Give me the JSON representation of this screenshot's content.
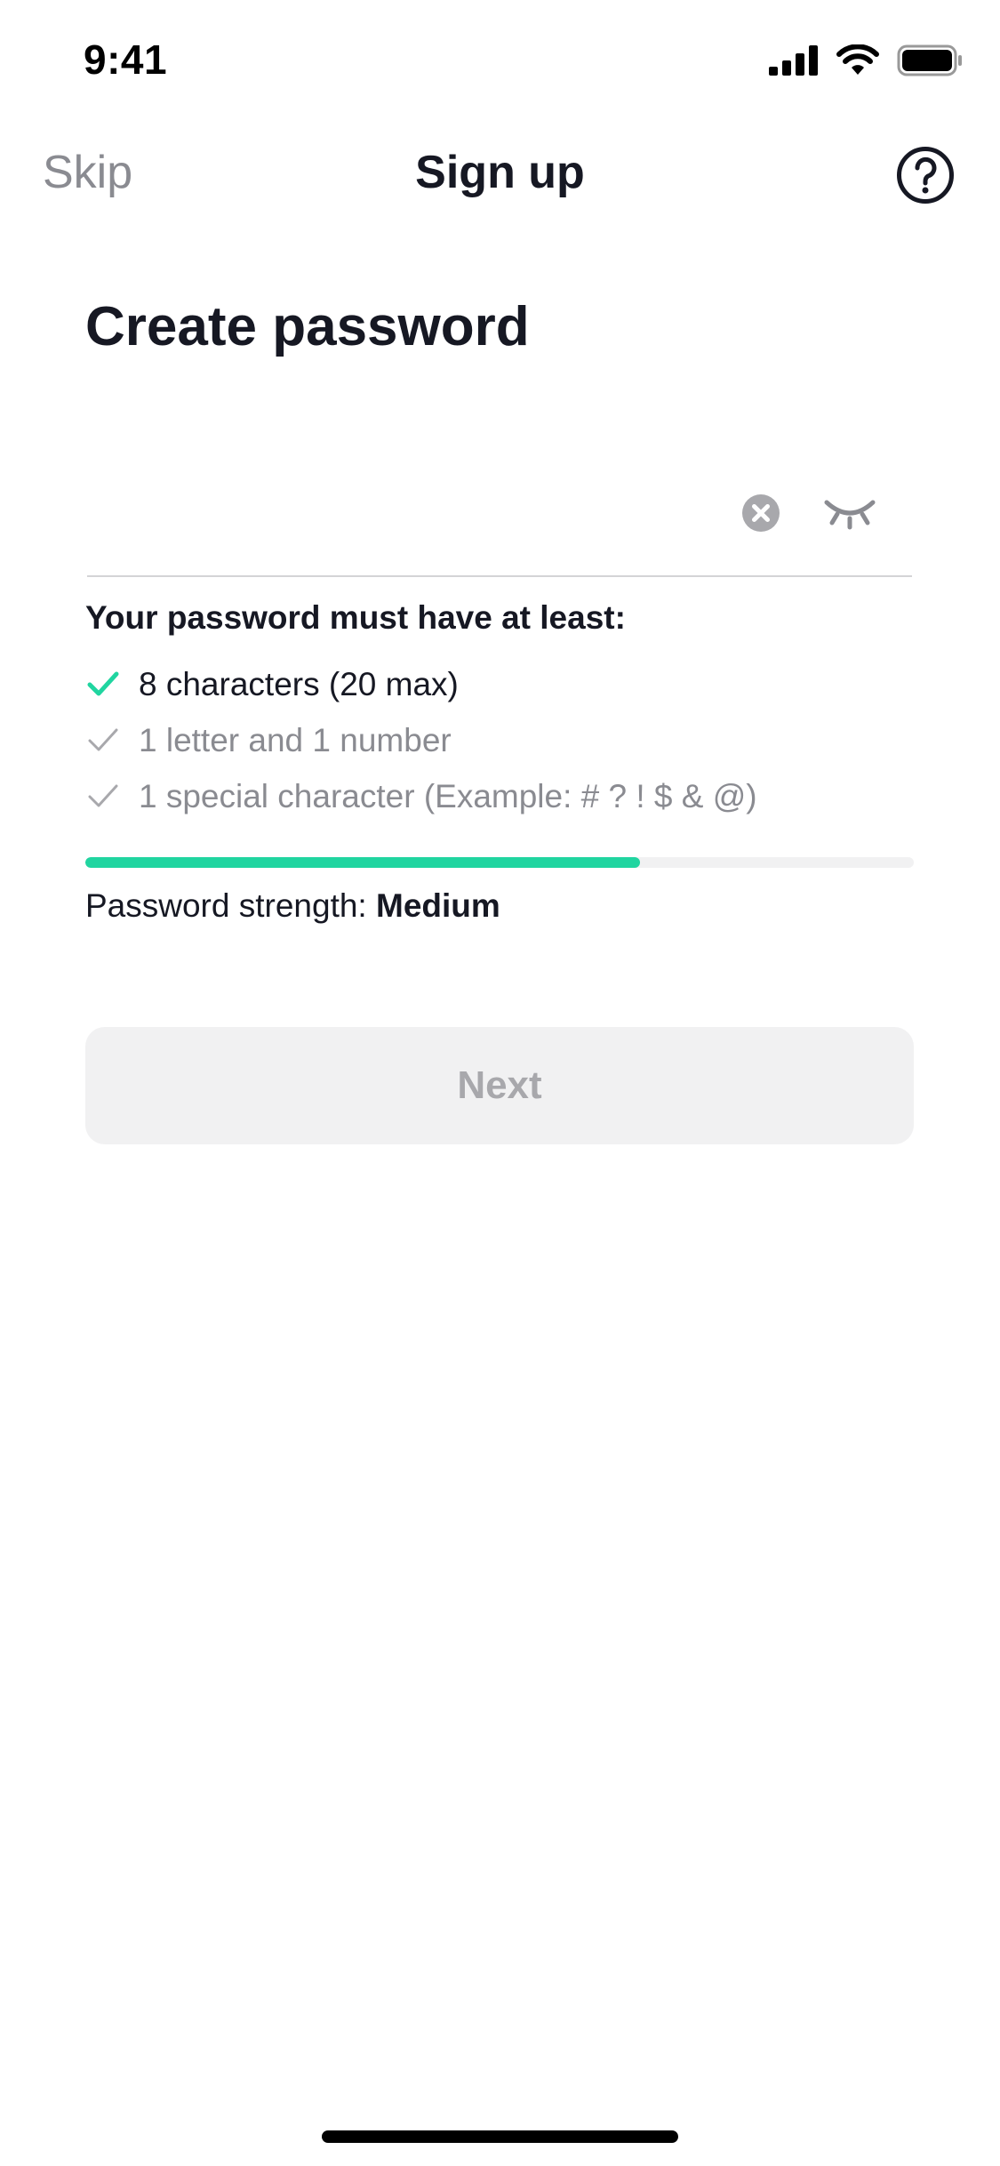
{
  "status_bar": {
    "time": "9:41"
  },
  "nav": {
    "skip_label": "Skip",
    "title": "Sign up",
    "help_icon": "question-circle-icon"
  },
  "page": {
    "title": "Create password"
  },
  "password_field": {
    "value": "",
    "placeholder": ""
  },
  "requirements": {
    "title": "Your password must have at least:",
    "items": [
      {
        "label": "8 characters (20 max)",
        "met": true
      },
      {
        "label": "1 letter and 1 number",
        "met": false
      },
      {
        "label": "1 special character (Example: # ? ! $ & @)",
        "met": false
      }
    ]
  },
  "strength": {
    "label": "Password strength:",
    "value": "Medium",
    "fill_fraction": 0.67
  },
  "next_button": {
    "label": "Next",
    "enabled": false
  },
  "colors": {
    "accent": "#20D5A0",
    "text": "#161823",
    "muted": "#8A8B91",
    "button_bg": "#F1F1F2"
  }
}
